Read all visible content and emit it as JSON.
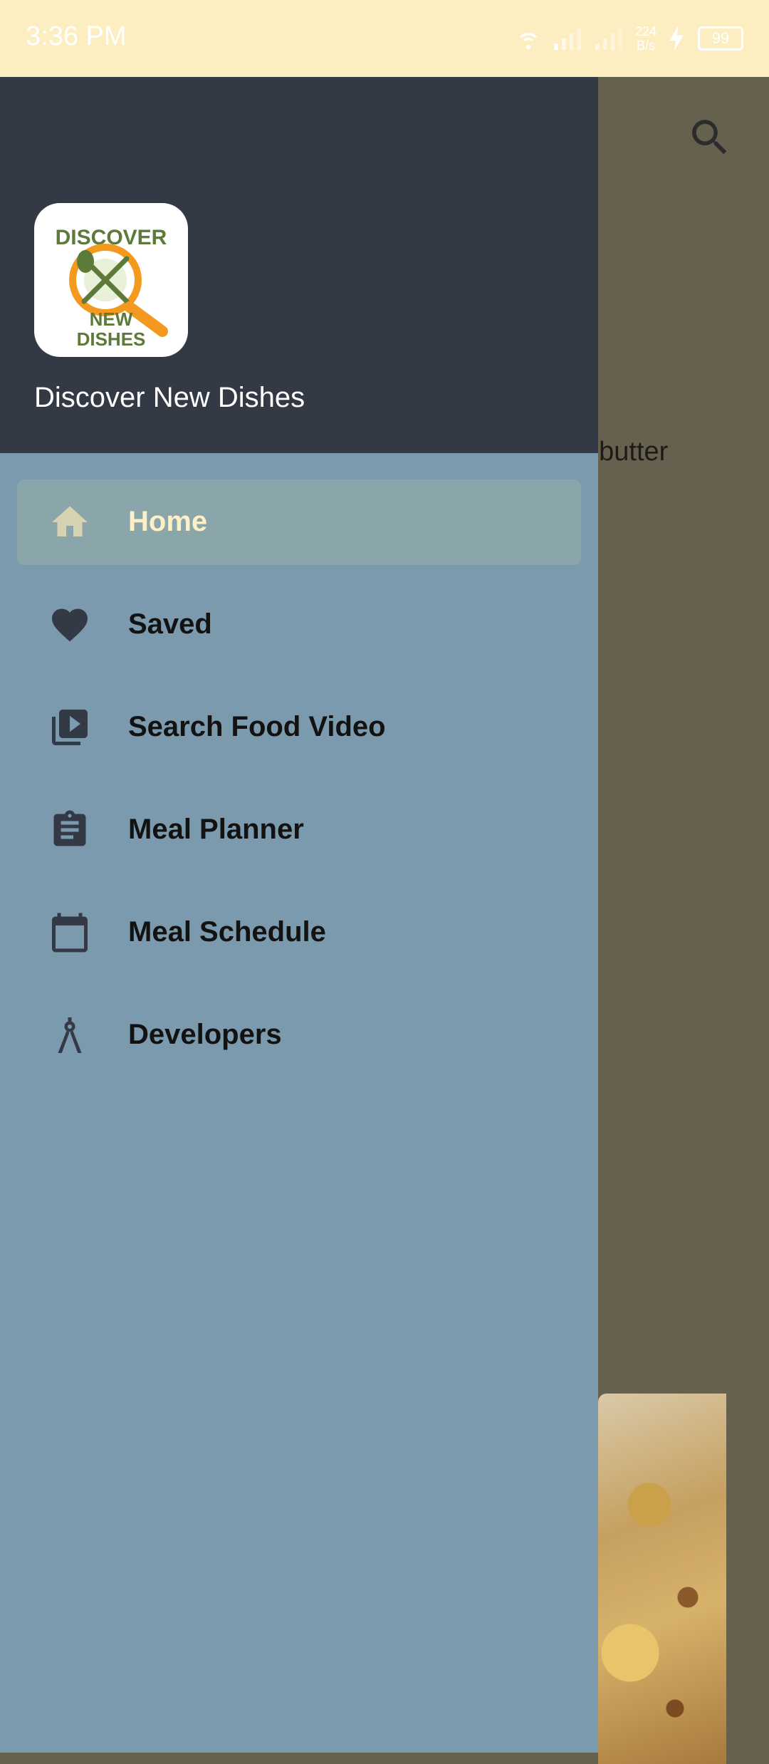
{
  "status_bar": {
    "time": "3:36 PM",
    "net_speed_value": "224",
    "net_speed_unit": "B/s",
    "battery": "99"
  },
  "background": {
    "visible_text": "t butter"
  },
  "drawer": {
    "app_name": "Discover New Dishes",
    "logo_text": "DISCOVER NEW DISHES",
    "items": [
      {
        "label": "Home",
        "icon": "home-icon",
        "active": true
      },
      {
        "label": "Saved",
        "icon": "heart-icon",
        "active": false
      },
      {
        "label": "Search Food Video",
        "icon": "video-library-icon",
        "active": false
      },
      {
        "label": "Meal Planner",
        "icon": "clipboard-icon",
        "active": false
      },
      {
        "label": "Meal Schedule",
        "icon": "calendar-icon",
        "active": false
      },
      {
        "label": "Developers",
        "icon": "compass-icon",
        "active": false
      }
    ]
  },
  "colors": {
    "status_bar_bg": "#fdeec1",
    "drawer_header_bg": "#333a45",
    "drawer_bg": "#7b9aad",
    "active_item_bg": "#8aa6aa",
    "active_item_text": "#fdf0c7",
    "scrim": "#66604f"
  }
}
